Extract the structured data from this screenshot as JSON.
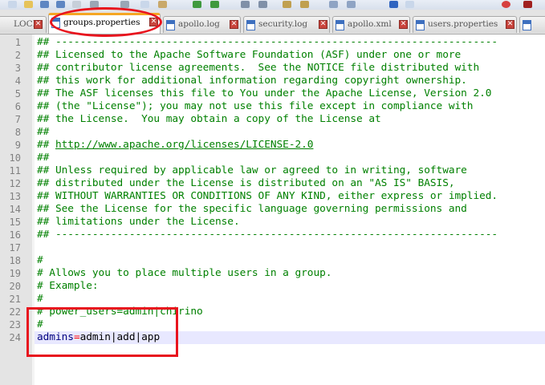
{
  "tabs": [
    {
      "label": "LOCK",
      "active": false
    },
    {
      "label": "groups.properties",
      "active": true
    },
    {
      "label": "apollo.log",
      "active": false
    },
    {
      "label": "security.log",
      "active": false
    },
    {
      "label": "apollo.xml",
      "active": false
    },
    {
      "label": "users.properties",
      "active": false
    }
  ],
  "close_glyph": "✕",
  "lines": [
    {
      "n": "1",
      "text": "## ------------------------------------------------------------------------"
    },
    {
      "n": "2",
      "text": "## Licensed to the Apache Software Foundation (ASF) under one or more"
    },
    {
      "n": "3",
      "text": "## contributor license agreements.  See the NOTICE file distributed with"
    },
    {
      "n": "4",
      "text": "## this work for additional information regarding copyright ownership."
    },
    {
      "n": "5",
      "text": "## The ASF licenses this file to You under the Apache License, Version 2.0"
    },
    {
      "n": "6",
      "text": "## (the \"License\"); you may not use this file except in compliance with"
    },
    {
      "n": "7",
      "text": "## the License.  You may obtain a copy of the License at"
    },
    {
      "n": "8",
      "text": "##"
    },
    {
      "n": "9",
      "text": "## ",
      "url": "http://www.apache.org/licenses/LICENSE-2.0"
    },
    {
      "n": "10",
      "text": "##"
    },
    {
      "n": "11",
      "text": "## Unless required by applicable law or agreed to in writing, software"
    },
    {
      "n": "12",
      "text": "## distributed under the License is distributed on an \"AS IS\" BASIS,"
    },
    {
      "n": "13",
      "text": "## WITHOUT WARRANTIES OR CONDITIONS OF ANY KIND, either express or implied."
    },
    {
      "n": "14",
      "text": "## See the License for the specific language governing permissions and"
    },
    {
      "n": "15",
      "text": "## limitations under the License."
    },
    {
      "n": "16",
      "text": "## ------------------------------------------------------------------------"
    },
    {
      "n": "17",
      "text": ""
    },
    {
      "n": "18",
      "text": "#"
    },
    {
      "n": "19",
      "text": "# Allows you to place multiple users in a group."
    },
    {
      "n": "20",
      "text": "# Example:"
    },
    {
      "n": "21",
      "text": "#"
    },
    {
      "n": "22",
      "text": "# power_users=admin|chirino"
    },
    {
      "n": "23",
      "text": "#"
    },
    {
      "n": "24",
      "key": "admins",
      "eq": "=",
      "val": "admin|add|app"
    }
  ]
}
